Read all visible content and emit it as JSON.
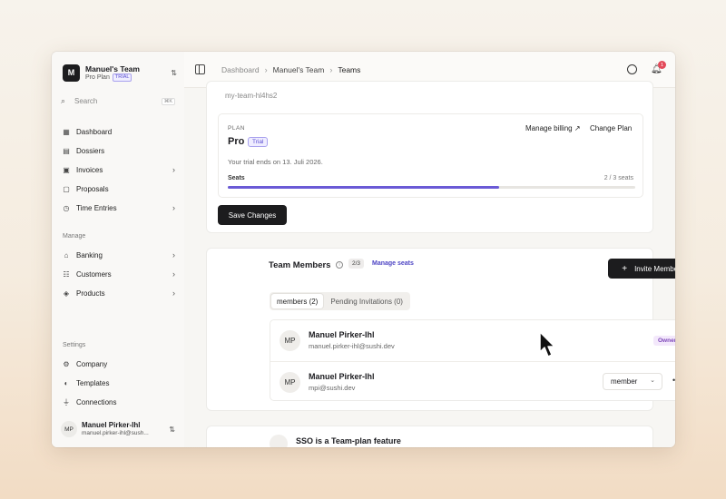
{
  "sidebar": {
    "team": {
      "logo_letter": "M",
      "name": "Manuel's Team",
      "plan": "Pro Plan",
      "badge": "TRIAL"
    },
    "search": {
      "placeholder": "Search",
      "shortcut": "⌘K"
    },
    "items": [
      {
        "label": "Dashboard",
        "icon": "dashboard-icon"
      },
      {
        "label": "Dossiers",
        "icon": "folder-icon"
      },
      {
        "label": "Invoices",
        "icon": "invoice-icon"
      },
      {
        "label": "Proposals",
        "icon": "document-icon"
      },
      {
        "label": "Time Entries",
        "icon": "clock-icon"
      }
    ],
    "manage_label": "Manage",
    "manage_items": [
      {
        "label": "Banking",
        "icon": "bank-icon"
      },
      {
        "label": "Customers",
        "icon": "users-icon"
      },
      {
        "label": "Products",
        "icon": "box-icon"
      }
    ],
    "settings_label": "Settings",
    "settings_items": [
      {
        "label": "Company",
        "icon": "gear-icon"
      },
      {
        "label": "Templates",
        "icon": "palette-icon"
      },
      {
        "label": "Connections",
        "icon": "plug-icon"
      }
    ],
    "user": {
      "initials": "MP",
      "name": "Manuel Pirker-Ihl",
      "email": "manuel.pirker-ihl@sush..."
    }
  },
  "header": {
    "breadcrumb": [
      "Dashboard",
      "Manuel's Team",
      "Teams"
    ],
    "notification_count": "1"
  },
  "team": {
    "slug": "my-team-hl4hs2",
    "plan": {
      "label": "PLAN",
      "name": "Pro",
      "badge": "Trial",
      "manage_billing": "Manage billing",
      "change_plan": "Change Plan",
      "trial_text": "Your trial ends on 13. Juli 2026.",
      "seats_label": "Seats",
      "seats_count": "2 / 3 seats",
      "seats_fraction": 0.667
    },
    "save_label": "Save Changes"
  },
  "members": {
    "title": "Team Members",
    "seat_pill": "2/3",
    "manage_seats": "Manage seats",
    "invite_label": "Invite Member",
    "tabs": [
      "members (2)",
      "Pending Invitations (0)"
    ],
    "rows": [
      {
        "initials": "MP",
        "name": "Manuel Pirker-Ihl",
        "email": "manuel.pirker-ihl@sushi.dev",
        "role": "Owner"
      },
      {
        "initials": "MP",
        "name": "Manuel Pirker-Ihl",
        "email": "mpi@sushi.dev",
        "role": "member"
      }
    ]
  },
  "sso": {
    "title": "SSO is a Team-plan feature"
  },
  "colors": {
    "accent": "#6a5ad6",
    "owner_badge": "#7c46b8",
    "notification": "#e34a5a"
  }
}
